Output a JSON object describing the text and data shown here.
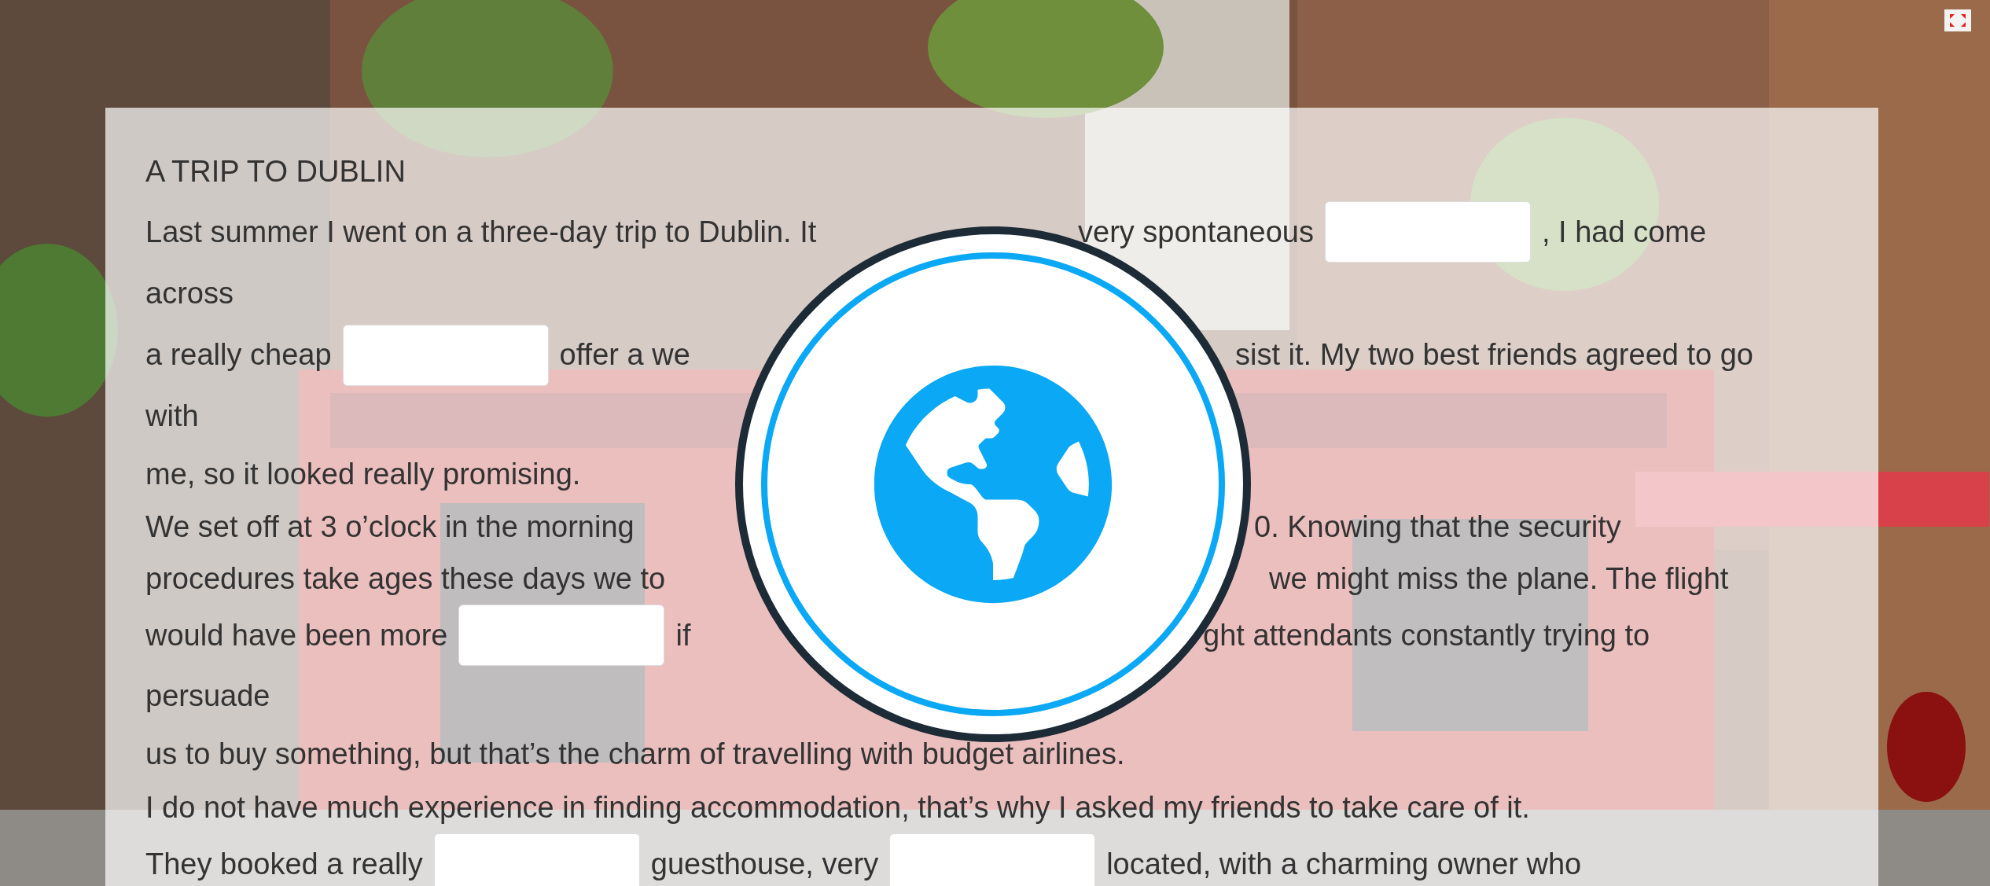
{
  "title": "A TRIP TO DUBLIN",
  "lines": [
    {
      "left": [
        {
          "kind": "text",
          "text": "Last summer I went on a three-day trip to Dublin. It"
        }
      ],
      "right": [
        {
          "kind": "text",
          "text": "very spontaneous"
        },
        {
          "kind": "blank"
        },
        {
          "kind": "text",
          "text": ", I had come"
        }
      ]
    },
    {
      "left": [
        {
          "kind": "text",
          "text": "across"
        }
      ]
    },
    {
      "left": [
        {
          "kind": "text",
          "text": "a really cheap"
        },
        {
          "kind": "blank"
        },
        {
          "kind": "text",
          "text": "offer a we"
        }
      ],
      "right": [
        {
          "kind": "text",
          "text": "sist it. My two best friends agreed to go"
        }
      ]
    },
    {
      "left": [
        {
          "kind": "text",
          "text": "with"
        }
      ]
    },
    {
      "left": [
        {
          "kind": "text",
          "text": "me, so it looked really promising."
        }
      ]
    },
    {
      "left": [
        {
          "kind": "text",
          "text": "We set off at 3 o’clock in the morning"
        }
      ],
      "right": [
        {
          "kind": "text",
          "text": "0. Knowing that the security"
        }
      ]
    },
    {
      "left": [
        {
          "kind": "text",
          "text": "procedures take ages these days we to"
        }
      ],
      "right": [
        {
          "kind": "text",
          "text": "we might miss the plane. The flight"
        }
      ]
    },
    {
      "left": [
        {
          "kind": "text",
          "text": "would have been more"
        },
        {
          "kind": "blank"
        },
        {
          "kind": "text",
          "text": "if"
        }
      ],
      "right": [
        {
          "kind": "text",
          "text": "ght attendants constantly trying to"
        }
      ]
    },
    {
      "left": [
        {
          "kind": "text",
          "text": "persuade"
        }
      ]
    },
    {
      "left": [
        {
          "kind": "text",
          "text": "us to buy something, but that’s the charm of travelling with budget airlines."
        }
      ]
    },
    {
      "left": [
        {
          "kind": "text",
          "text": "I do not have much experience in finding accommodation, that’s why I asked my friends to take care of it."
        }
      ]
    },
    {
      "left": [
        {
          "kind": "text",
          "text": "They booked a really"
        },
        {
          "kind": "blank"
        },
        {
          "kind": "text",
          "text": "guesthouse, very"
        },
        {
          "kind": "blank"
        },
        {
          "kind": "text",
          "text": "located, with a charming owner who"
        }
      ]
    }
  ]
}
